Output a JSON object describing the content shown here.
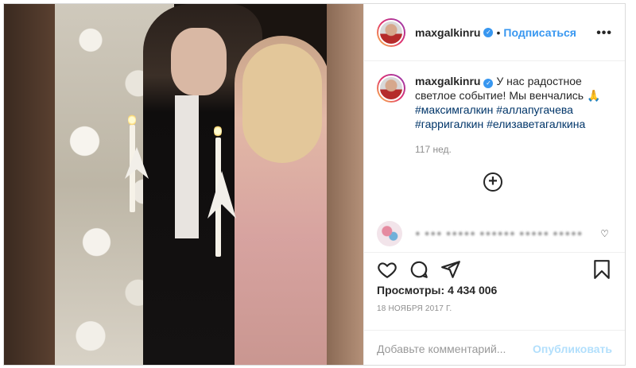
{
  "header": {
    "username": "maxgalkinru",
    "dot": "•",
    "follow_label": "Подписаться",
    "more_label": "•••"
  },
  "caption": {
    "username": "maxgalkinru",
    "text": "У нас радостное светлое событие! Мы венчались 🙏",
    "hashtags": [
      "#максимгалкин",
      "#аллапугачева",
      "#гарригалкин",
      "#елизаветагалкина"
    ],
    "ago": "117 нед."
  },
  "comment": {
    "blurred_text": "● ●●● ●●●●● ●●●●●● ●●●●● ●●●●●"
  },
  "stats": {
    "views_label": "Просмотры:",
    "views_value": "4 434 006",
    "date": "18 НОЯБРЯ 2017 Г."
  },
  "add_comment": {
    "placeholder": "Добавьте комментарий...",
    "publish_label": "Опубликовать"
  },
  "icons": {
    "like": "heart-icon",
    "comment": "comment-icon",
    "share": "share-icon",
    "save": "bookmark-icon",
    "more_comments": "plus-circle-icon"
  },
  "colors": {
    "accent": "#3897f0",
    "hashtag": "#003569",
    "muted": "#8e8e8e",
    "publish_disabled": "#b2dffc"
  }
}
